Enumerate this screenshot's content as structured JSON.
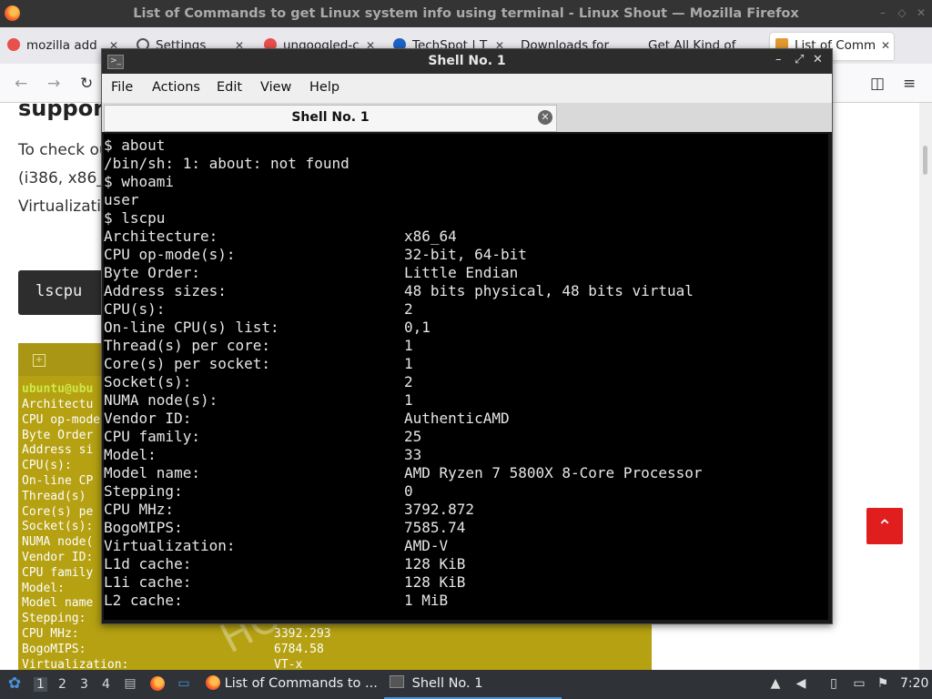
{
  "browser": {
    "window_title": "List of Commands to get Linux system info using terminal - Linux Shout — Mozilla Firefox",
    "tabs": [
      {
        "label": "mozilla add",
        "icon": "pocket-icon",
        "color": "#e8504d"
      },
      {
        "label": "Settings",
        "icon": "gear-icon",
        "color": "#555555"
      },
      {
        "label": "ungoogled-c",
        "icon": "ungoogled-icon",
        "color": "#e8504d"
      },
      {
        "label": "TechSpot | T",
        "icon": "techspot-icon",
        "color": "#1e63c5"
      },
      {
        "label": "Downloads for",
        "icon": "",
        "color": ""
      },
      {
        "label": "Get All Kind of",
        "icon": "",
        "color": ""
      },
      {
        "label": "List of Comm",
        "icon": "linuxshout-icon",
        "color": "#e39b32"
      }
    ],
    "new_tab_label": "+"
  },
  "webpage": {
    "heading": "support",
    "lines": [
      "To check ou",
      "(i386, x86_",
      "Virtualizati"
    ],
    "code_command": "lscpu",
    "image": {
      "user_prompt": "ubuntu@ubu",
      "rows": [
        {
          "label": "Architectu",
          "value": ""
        },
        {
          "label": "CPU op-mode",
          "value": ""
        },
        {
          "label": "Byte Order",
          "value": ""
        },
        {
          "label": "Address si",
          "value": ""
        },
        {
          "label": "CPU(s):",
          "value": ""
        },
        {
          "label": "On-line CP",
          "value": ""
        },
        {
          "label": "Thread(s) ",
          "value": ""
        },
        {
          "label": "Core(s) pe",
          "value": ""
        },
        {
          "label": "Socket(s):",
          "value": ""
        },
        {
          "label": "NUMA node(",
          "value": ""
        },
        {
          "label": "Vendor ID:",
          "value": ""
        },
        {
          "label": "CPU family",
          "value": ""
        },
        {
          "label": "Model:",
          "value": ""
        },
        {
          "label": "Model name",
          "value": ""
        },
        {
          "label": "Stepping:",
          "value": ""
        },
        {
          "label": "CPU MHz:",
          "value": "3392.293"
        },
        {
          "label": "BogoMIPS:",
          "value": "6784.58"
        },
        {
          "label": "Virtualization:",
          "value": "VT-x"
        }
      ],
      "watermark": "HO"
    }
  },
  "terminal": {
    "window_title": "Shell No. 1",
    "menu": [
      "File",
      "Actions",
      "Edit",
      "View",
      "Help"
    ],
    "tab_label": "Shell No. 1",
    "lines": [
      {
        "text": "$ about",
        "value": ""
      },
      {
        "text": "/bin/sh: 1: about: not found",
        "value": ""
      },
      {
        "text": "$ whoami",
        "value": ""
      },
      {
        "text": "user",
        "value": ""
      },
      {
        "text": "$ lscpu",
        "value": ""
      },
      {
        "text": "Architecture:",
        "value": "x86_64"
      },
      {
        "text": "CPU op-mode(s):",
        "value": "32-bit, 64-bit"
      },
      {
        "text": "Byte Order:",
        "value": "Little Endian"
      },
      {
        "text": "Address sizes:",
        "value": "48 bits physical, 48 bits virtual"
      },
      {
        "text": "CPU(s):",
        "value": "2"
      },
      {
        "text": "On-line CPU(s) list:",
        "value": "0,1"
      },
      {
        "text": "Thread(s) per core:",
        "value": "1"
      },
      {
        "text": "Core(s) per socket:",
        "value": "1"
      },
      {
        "text": "Socket(s):",
        "value": "2"
      },
      {
        "text": "NUMA node(s):",
        "value": "1"
      },
      {
        "text": "Vendor ID:",
        "value": "AuthenticAMD"
      },
      {
        "text": "CPU family:",
        "value": "25"
      },
      {
        "text": "Model:",
        "value": "33"
      },
      {
        "text": "Model name:",
        "value": "AMD Ryzen 7 5800X 8-Core Processor"
      },
      {
        "text": "Stepping:",
        "value": "0"
      },
      {
        "text": "CPU MHz:",
        "value": "3792.872"
      },
      {
        "text": "BogoMIPS:",
        "value": "7585.74"
      },
      {
        "text": "Virtualization:",
        "value": "AMD-V"
      },
      {
        "text": "L1d cache:",
        "value": "128 KiB"
      },
      {
        "text": "L1i cache:",
        "value": "128 KiB"
      },
      {
        "text": "L2 cache:",
        "value": "1 MiB"
      }
    ]
  },
  "taskbar": {
    "workspaces": [
      "1",
      "2",
      "3",
      "4"
    ],
    "tasks": [
      {
        "label": "List of Commands to ...",
        "icon": "firefox-icon"
      },
      {
        "label": "Shell No. 1",
        "icon": "terminal-icon"
      }
    ],
    "clock": "7:20"
  }
}
